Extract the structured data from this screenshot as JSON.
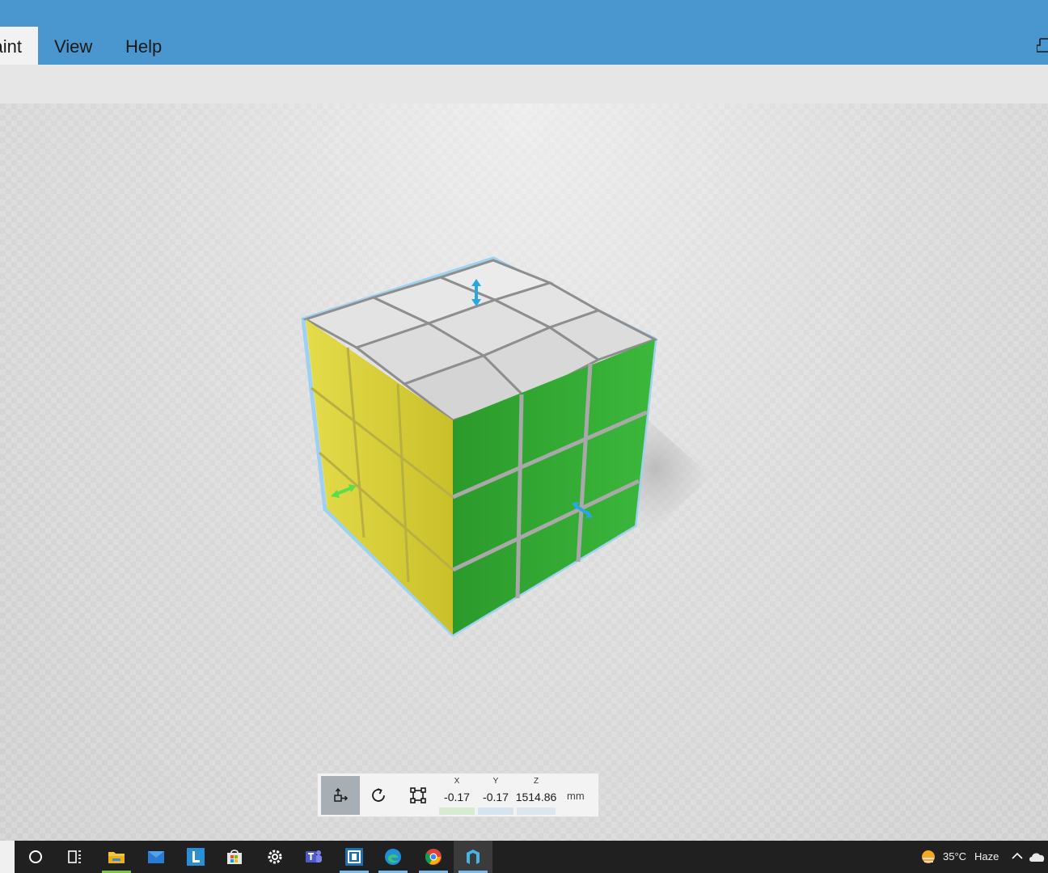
{
  "menu": {
    "tabs": [
      {
        "label": "Paint"
      },
      {
        "label": "View"
      },
      {
        "label": "Help"
      }
    ]
  },
  "transform_bar": {
    "coords": [
      {
        "axis": "X",
        "value": "-0.17"
      },
      {
        "axis": "Y",
        "value": "-0.17"
      },
      {
        "axis": "Z",
        "value": "1514.86"
      }
    ],
    "unit": "mm",
    "tools": [
      "move-tool",
      "rotate-tool",
      "scale-tool"
    ]
  },
  "viewport": {
    "object": "rubiks-cube",
    "cube_colors": {
      "top": "#d8d8d8",
      "left": "#d6cc2e",
      "right": "#2fa52f"
    },
    "gizmo_colors": {
      "vertical": "#29a8e0",
      "x_axis": "#5fdc4b",
      "y_axis": "#29a8e0"
    }
  },
  "taskbar": {
    "icons": [
      "cortana-search-icon",
      "task-view-icon",
      "file-explorer-icon",
      "mail-icon",
      "l-app-icon",
      "store-icon",
      "settings-icon",
      "teams-icon",
      "app-icon",
      "edge-icon",
      "chrome-icon",
      "3d-builder-icon"
    ],
    "weather": {
      "temp": "35°C",
      "condition": "Haze"
    }
  },
  "colors": {
    "accent": "#4a97cf",
    "taskbar": "#202020"
  }
}
